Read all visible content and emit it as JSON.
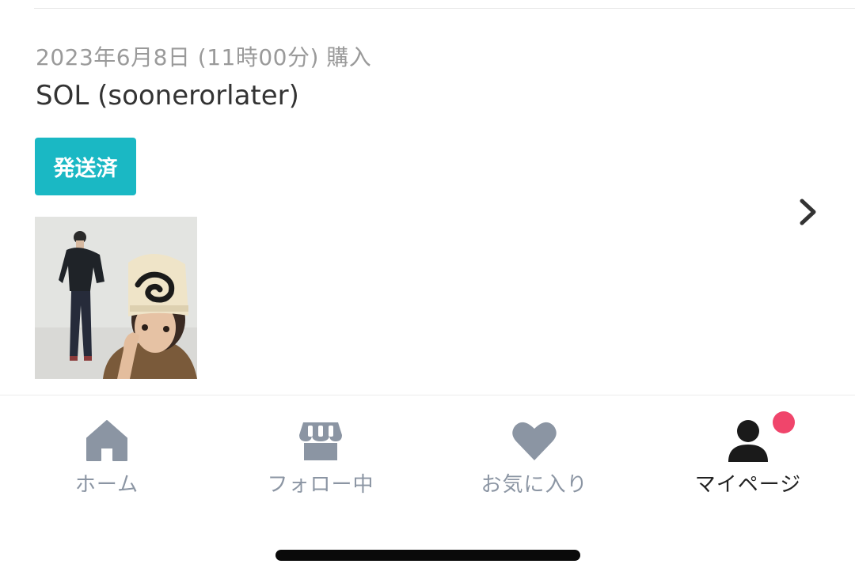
{
  "order": {
    "purchase_date": "2023年6月8日 (11時00分) 購入",
    "shop_name": "SOL (soonerorlater)",
    "status": "発送済",
    "status_color": "#1ab8c4",
    "thumbnail_description": "product-photo"
  },
  "tabbar": {
    "inactive_color": "#8b95a3",
    "active_color": "#222222",
    "notification_color": "#f0456b",
    "items": [
      {
        "label": "ホーム",
        "icon": "home-icon",
        "active": false
      },
      {
        "label": "フォロー中",
        "icon": "shop-icon",
        "active": false
      },
      {
        "label": "お気に入り",
        "icon": "heart-icon",
        "active": false
      },
      {
        "label": "マイページ",
        "icon": "user-icon",
        "active": true,
        "notification": true
      }
    ]
  }
}
